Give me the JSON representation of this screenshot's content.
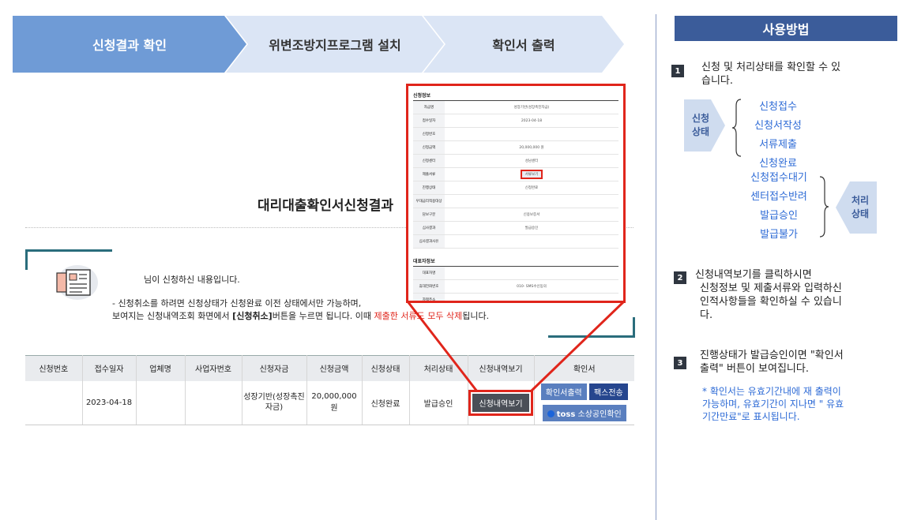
{
  "steps": [
    "신청결과 확인",
    "위변조방지프로그램 설치",
    "확인서 출력"
  ],
  "page_title": "대리대출확인서신청결과",
  "notice": {
    "line1": "님이 신청하신 내용입니다.",
    "line2": "- 신청취소를 하려면 신청상태가 신청완료 이전 상태에서만 가능하며,",
    "line3_a": "보여지는 신청내역조회 화면에서 ",
    "line3_b": "[신청취소]",
    "line3_c": "버튼을 누르면 됩니다. 이때 ",
    "line3_d": "제출한 서류도 모두 삭제",
    "line3_e": "됩니다."
  },
  "table": {
    "headers": [
      "신청번호",
      "접수일자",
      "업체명",
      "사업자번호",
      "신청자금",
      "신청금액",
      "신청상태",
      "처리상태",
      "신청내역보기",
      "확인서"
    ],
    "row": {
      "no": "",
      "date": "2023-04-18",
      "company": "",
      "bizno": "",
      "fund": "성장기반(성장촉진자금)",
      "amount": "20,000,000 원",
      "state": "신청완료",
      "proc": "발급승인",
      "view_btn": "신청내역보기",
      "print_btn": "확인서출력",
      "fax_btn": "팩스전송",
      "toss_btn": "소상공인확인",
      "toss_brand": "toss"
    }
  },
  "zoom": {
    "section1": "신청정보",
    "rows1": [
      {
        "k": "자금명",
        "v": "성장기반(성장촉진자금)"
      },
      {
        "k": "접수일자",
        "v": "2023-04-18"
      },
      {
        "k": "신청번호",
        "v": ""
      },
      {
        "k": "신청금액",
        "v": "20,000,000 원"
      },
      {
        "k": "신청센터",
        "v": "성남센터"
      },
      {
        "k": "제출서류",
        "v": "서류보기"
      },
      {
        "k": "진행상태",
        "v": "신청완료"
      },
      {
        "k": "우대금리적용대상",
        "v": ""
      },
      {
        "k": "담보구분",
        "v": "신용보증서"
      },
      {
        "k": "심사결과",
        "v": "발급승인"
      },
      {
        "k": "심사결과사유",
        "v": ""
      }
    ],
    "section2": "대표자정보",
    "rows2": [
      {
        "k": "대표자명",
        "v": ""
      },
      {
        "k": "휴대전화번호",
        "v": "010-        SMS수신동의"
      },
      {
        "k": "자택주소",
        "v": ""
      }
    ]
  },
  "guide": {
    "title": "사용방법",
    "n1": "1",
    "text1a": "신청 및 처리상태를 확인할 수 있",
    "text1b": "습니다.",
    "apply_badge": [
      "신청",
      "상태"
    ],
    "apply_states": [
      "신청접수",
      "신청서작성",
      "서류제출",
      "신청완료"
    ],
    "proc_states": [
      "신청접수대기",
      "센터접수반려",
      "발급승인",
      "발급불가"
    ],
    "proc_badge": [
      "처리",
      "상태"
    ],
    "n2": "2",
    "text2": [
      "신청내역보기를 클릭하시면",
      "신청정보 및 제출서류와 입력하신",
      "인적사항들을 확인하실 수 있습니",
      "다."
    ],
    "n3": "3",
    "text3": [
      "진행상태가 발급승인이면 \"확인서",
      "출력\" 버튼이 보여집니다."
    ],
    "note3": [
      "* 확인서는 유효기간내에 재 출력이",
      "가능하며, 유효기간이 지나면 \" 유효",
      "기간만료\"로 표시됩니다."
    ]
  }
}
